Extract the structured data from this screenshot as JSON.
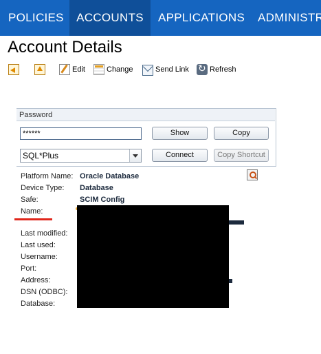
{
  "nav": {
    "tabs": [
      {
        "label": "POLICIES"
      },
      {
        "label": "ACCOUNTS",
        "active": true
      },
      {
        "label": "APPLICATIONS"
      },
      {
        "label": "ADMINISTR"
      }
    ],
    "bg_color": "#1565c0",
    "active_bg_color": "#0f4f99"
  },
  "page": {
    "title": "Account Details"
  },
  "toolbar": {
    "back_icon": "back-arrow-icon",
    "up_icon": "up-arrow-icon",
    "edit_label": "Edit",
    "change_label": "Change",
    "send_link_label": "Send Link",
    "refresh_label": "Refresh"
  },
  "password_panel": {
    "header": "Password",
    "masked_value": "******",
    "show_label": "Show",
    "copy_label": "Copy",
    "connection_selected": "SQL*Plus",
    "connect_label": "Connect",
    "copy_shortcut_label": "Copy Shortcut"
  },
  "details": {
    "platform_name": {
      "label": "Platform Name:",
      "value": "Oracle Database"
    },
    "device_type": {
      "label": "Device Type:",
      "value": "Database"
    },
    "safe": {
      "label": "Safe:",
      "value": "SCIM Config"
    },
    "name": {
      "label": "Name:"
    },
    "last_modified": {
      "label": "Last modified:"
    },
    "last_used": {
      "label": "Last used:"
    },
    "username": {
      "label": "Username:"
    },
    "port": {
      "label": "Port:"
    },
    "address": {
      "label": "Address:"
    },
    "dsn": {
      "label": "DSN (ODBC):"
    },
    "database": {
      "label": "Database:"
    }
  },
  "colors": {
    "highlight_underline": "#e0261b",
    "redaction": "#000000"
  }
}
